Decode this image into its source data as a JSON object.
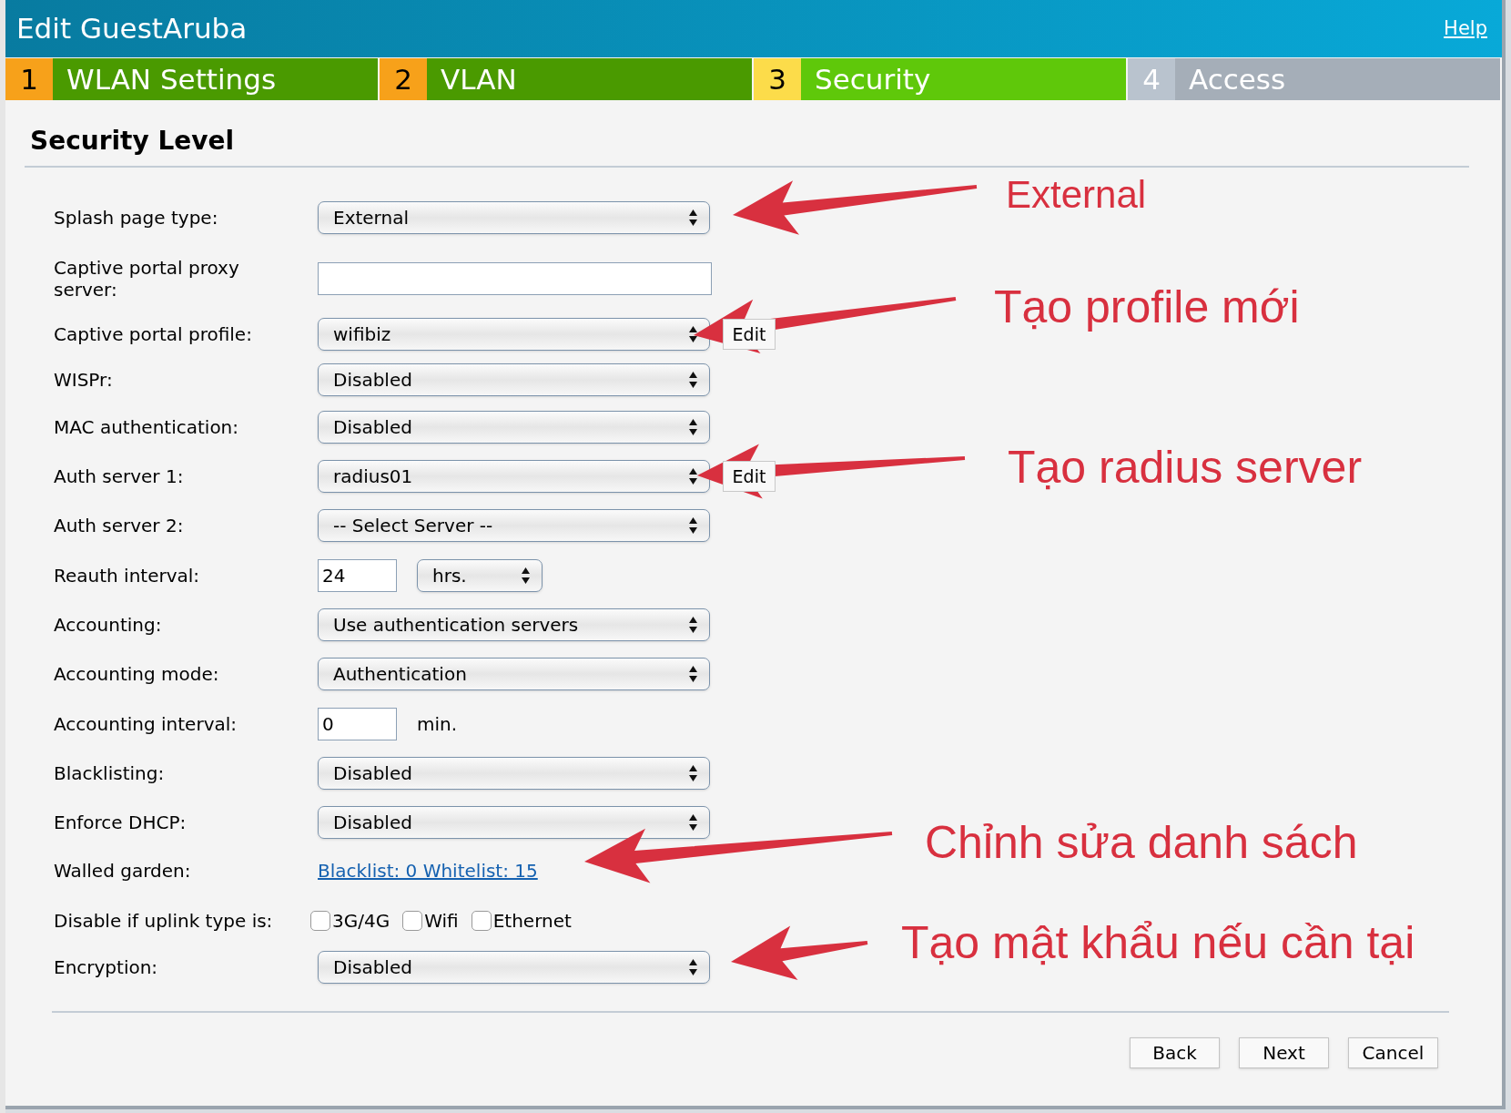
{
  "window": {
    "title": "Edit GuestAruba",
    "help_link": "Help"
  },
  "steps": [
    {
      "number": "1",
      "label": "WLAN Settings",
      "selected": false,
      "disabled": false
    },
    {
      "number": "2",
      "label": "VLAN",
      "selected": false,
      "disabled": false
    },
    {
      "number": "3",
      "label": "Security",
      "selected": true,
      "disabled": false
    },
    {
      "number": "4",
      "label": "Access",
      "selected": false,
      "disabled": true
    }
  ],
  "section_title": "Security Level",
  "fields": [
    {
      "kind": "select",
      "label": "Splash page type:",
      "value": "External"
    },
    {
      "kind": "text",
      "label": "Captive portal proxy server:"
    },
    {
      "kind": "select",
      "label": "Captive portal profile:",
      "value": "wifibiz",
      "button": "Edit"
    },
    {
      "kind": "select",
      "label": "WISPr:",
      "value": "Disabled"
    },
    {
      "kind": "select",
      "label": "MAC authentication:",
      "value": "Disabled"
    },
    {
      "kind": "select",
      "label": "Auth server 1:",
      "value": "radius01",
      "button": "Edit"
    },
    {
      "kind": "select",
      "label": "Auth server 2:",
      "value": "-- Select Server --"
    },
    {
      "kind": "number_unit",
      "label": "Reauth interval:",
      "value": "24",
      "unit": "hrs."
    },
    {
      "kind": "select",
      "label": "Accounting:",
      "value": "Use authentication servers"
    },
    {
      "kind": "select",
      "label": "Accounting mode:",
      "value": "Authentication"
    },
    {
      "kind": "number_suffix",
      "label": "Accounting interval:",
      "value": "0",
      "suffix": "min."
    },
    {
      "kind": "select",
      "label": "Blacklisting:",
      "value": "Disabled"
    },
    {
      "kind": "select",
      "label": "Enforce DHCP:",
      "value": "Disabled"
    },
    {
      "kind": "link",
      "label": "Walled garden:",
      "value": "Blacklist: 0 Whitelist: 15"
    },
    {
      "kind": "checkboxes",
      "label": "Disable if uplink type is:",
      "options": [
        {
          "label": "3G/4G",
          "checked": false
        },
        {
          "label": "Wifi",
          "checked": false
        },
        {
          "label": "Ethernet",
          "checked": false
        }
      ]
    },
    {
      "kind": "select",
      "label": "Encryption:",
      "value": "Disabled"
    }
  ],
  "buttons": [
    "Back",
    "Next",
    "Cancel"
  ],
  "annotations": [
    "External",
    "Tạo profile mới",
    "Tạo radius server",
    "Chỉnh sửa danh sách",
    "Tạo mật khẩu nếu cần tại"
  ]
}
